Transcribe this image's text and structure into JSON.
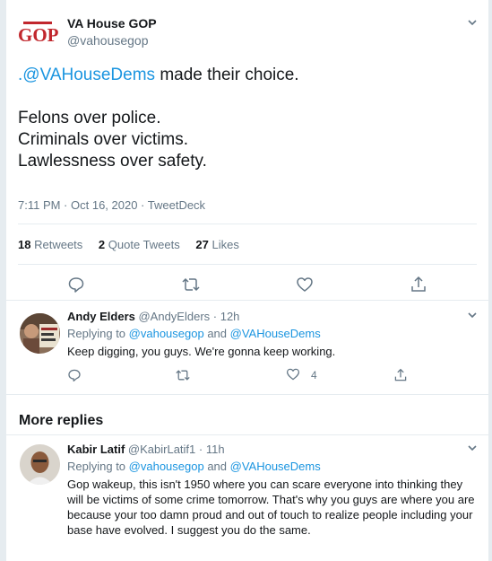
{
  "main_tweet": {
    "logo_text": "GOP",
    "author_name": "VA House GOP",
    "author_handle": "@vahousegop",
    "mention": ".@VAHouseDems",
    "text_after_mention": " made their choice.",
    "lines": [
      "Felons over police.",
      "Criminals over victims.",
      "Lawlessness over safety."
    ],
    "meta": "7:11 PM · Oct 16, 2020 · TweetDeck",
    "stats": {
      "retweets_count": "18",
      "retweets_label": "Retweets",
      "quotes_count": "2",
      "quotes_label": "Quote Tweets",
      "likes_count": "27",
      "likes_label": "Likes"
    }
  },
  "reply1": {
    "name": "Andy Elders",
    "handle_time": "@AndyElders · 12h",
    "replying_prefix": "Replying to ",
    "replying_to_1": "@vahousegop",
    "replying_and": " and ",
    "replying_to_2": "@VAHouseDems",
    "text": "Keep digging, you guys. We're gonna keep working.",
    "like_count": "4"
  },
  "more_replies_label": "More replies",
  "reply2": {
    "name": "Kabir Latif",
    "handle_time": "@KabirLatif1 · 11h",
    "replying_prefix": "Replying to ",
    "replying_to_1": "@vahousegop",
    "replying_and": " and ",
    "replying_to_2": "@VAHouseDems",
    "text": "Gop wakeup, this isn't 1950 where you can scare everyone into thinking they will be victims of some crime tomorrow. That's why you guys are where you are because your too damn proud and out of touch to realize people including your base have evolved. I suggest you do the same."
  },
  "colors": {
    "link": "#1b95e0",
    "muted": "#657786",
    "logo": "#c1272d"
  }
}
